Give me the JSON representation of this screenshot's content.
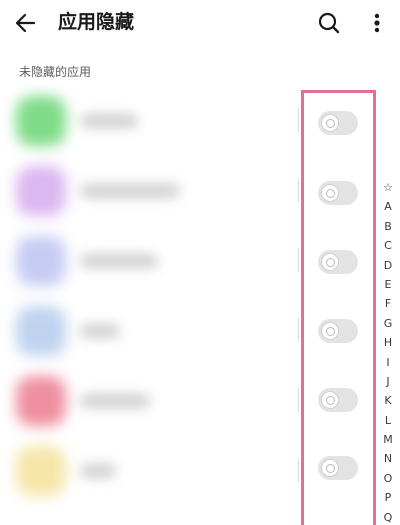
{
  "header": {
    "title": "应用隐藏"
  },
  "section_label": "未隐藏的应用",
  "apps": [
    {
      "icon_color": "#7fdc88",
      "toggle_on": false
    },
    {
      "icon_color": "#dcb7f1",
      "toggle_on": false
    },
    {
      "icon_color": "#c7ccf4",
      "toggle_on": false
    },
    {
      "icon_color": "#bfd3ef",
      "toggle_on": false
    },
    {
      "icon_color": "#ef8fa0",
      "toggle_on": false
    },
    {
      "icon_color": "#f6e6a8",
      "toggle_on": false
    }
  ],
  "alphabet_index": [
    "☆",
    "A",
    "B",
    "C",
    "D",
    "E",
    "F",
    "G",
    "H",
    "I",
    "J",
    "K",
    "L",
    "M",
    "N",
    "O",
    "P",
    "Q"
  ],
  "colors": {
    "highlight_border": "#e0709a",
    "toggle_off": "#e3e3e3"
  },
  "icons": {
    "back": "back-arrow-icon",
    "search": "search-icon",
    "more": "more-vertical-icon"
  }
}
